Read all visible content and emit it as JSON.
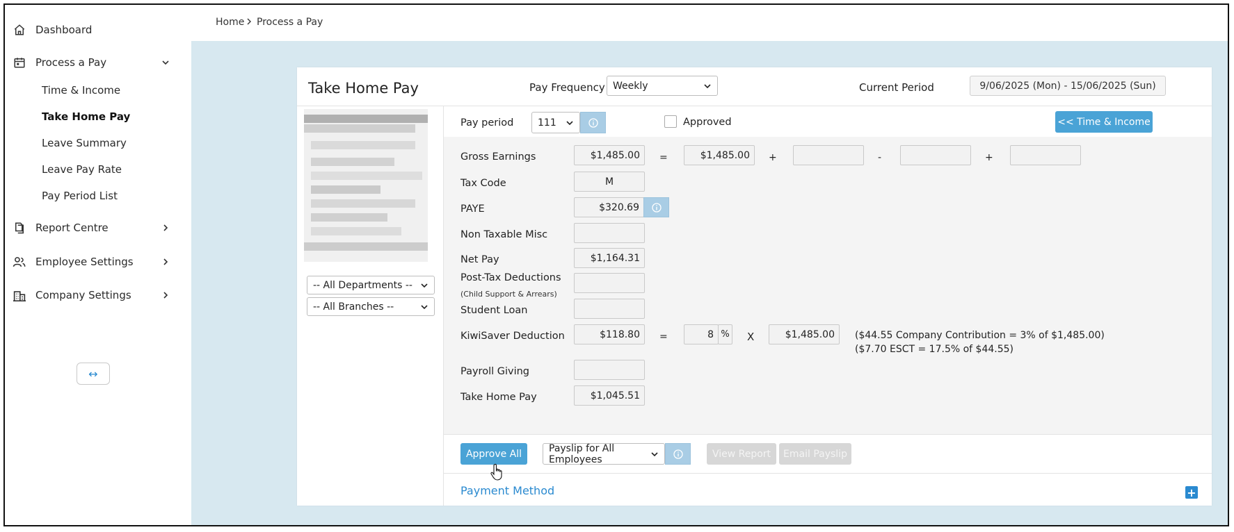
{
  "sidebar": {
    "dashboard": "Dashboard",
    "process_pay": "Process a Pay",
    "sub_items": [
      "Time & Income",
      "Take Home Pay",
      "Leave Summary",
      "Leave Pay Rate",
      "Pay Period List"
    ],
    "report_centre": "Report Centre",
    "employee_settings": "Employee Settings",
    "company_settings": "Company Settings",
    "collapse_icon": "↔"
  },
  "breadcrumb": {
    "home": "Home",
    "current": "Process a Pay"
  },
  "card": {
    "title": "Take Home Pay",
    "pay_frequency_label": "Pay Frequency",
    "pay_frequency_value": "Weekly",
    "current_period_label": "Current Period",
    "current_period_value": "9/06/2025 (Mon) - 15/06/2025 (Sun)",
    "pay_period_label": "Pay period",
    "pay_period_value": "111",
    "approved_label": "Approved",
    "time_income_button": "<< Time & Income",
    "departments_value": "-- All Departments --",
    "branches_value": "-- All Branches --"
  },
  "fields": {
    "gross_earnings": {
      "label": "Gross Earnings",
      "value": "$1,485.00",
      "eq": "=",
      "part1": "$1,485.00",
      "op1": "+",
      "op2": "-",
      "op3": "+"
    },
    "tax_code": {
      "label": "Tax Code",
      "value": "M"
    },
    "paye": {
      "label": "PAYE",
      "value": "$320.69"
    },
    "non_taxable": {
      "label": "Non Taxable Misc",
      "value": ""
    },
    "net_pay": {
      "label": "Net Pay",
      "value": "$1,164.31"
    },
    "post_tax": {
      "label": "Post-Tax Deductions",
      "sublabel": "(Child Support & Arrears)",
      "value": ""
    },
    "student_loan": {
      "label": "Student Loan",
      "value": ""
    },
    "kiwisaver": {
      "label": "KiwiSaver Deduction",
      "value": "$118.80",
      "eq": "=",
      "rate": "8",
      "pct": "%",
      "times": "X",
      "base": "$1,485.00",
      "note1": "($44.55 Company Contribution = 3% of $1,485.00)",
      "note2": "($7.70 ESCT = 17.5% of $44.55)"
    },
    "payroll_giving": {
      "label": "Payroll Giving",
      "value": ""
    },
    "take_home_pay": {
      "label": "Take Home Pay",
      "value": "$1,045.51"
    }
  },
  "actions": {
    "approve_all": "Approve All",
    "payslip_select": "Payslip for All Employees",
    "view_report": "View Report",
    "email_payslip": "Email Payslip"
  },
  "payment_method": {
    "title": "Payment Method",
    "toggle": "+"
  }
}
